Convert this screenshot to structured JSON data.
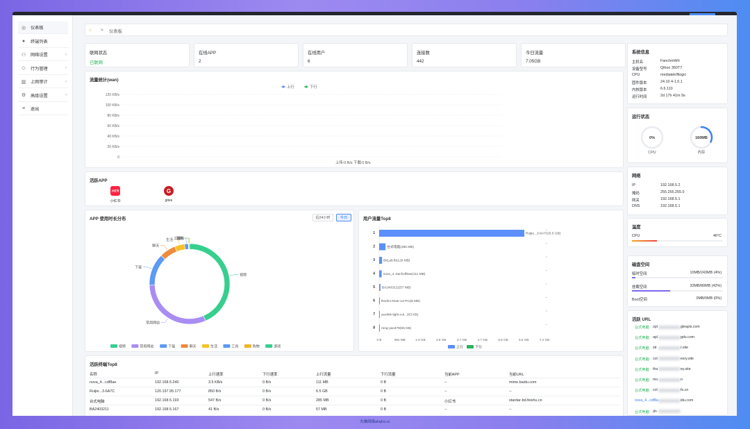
{
  "sidebar": {
    "items": [
      {
        "label": "仪表板",
        "icon": "dashboard-icon",
        "glyph": "◎",
        "arrow": ""
      },
      {
        "label": "终端列表",
        "icon": "user-icon",
        "glyph": "●",
        "arrow": ""
      },
      {
        "label": "网络设置",
        "icon": "network-icon",
        "glyph": "⚇",
        "arrow": "›"
      },
      {
        "label": "行为管理",
        "icon": "shield-icon",
        "glyph": "◇",
        "arrow": "›"
      },
      {
        "label": "上网审计",
        "icon": "audit-icon",
        "glyph": "▥",
        "arrow": "›"
      },
      {
        "label": "高级设置",
        "icon": "gear-icon",
        "glyph": "⚙",
        "arrow": "›"
      },
      {
        "label": "退出",
        "icon": "logout-icon",
        "glyph": "≡",
        "arrow": ""
      }
    ]
  },
  "breadcrumb": {
    "home_glyph": "⌂",
    "sep": ">",
    "current": "仪表板"
  },
  "stats": [
    {
      "label": "联网状态",
      "value": "已联网",
      "green": true
    },
    {
      "label": "在线APP",
      "value": "2",
      "green": false
    },
    {
      "label": "在线用户",
      "value": "6",
      "green": false
    },
    {
      "label": "连接数",
      "value": "442",
      "green": false
    },
    {
      "label": "今日流量",
      "value": "7.05GB",
      "green": false
    }
  ],
  "traffic": {
    "title": "流量统计(wan)",
    "legend": [
      "上行",
      "下行"
    ],
    "legend_colors": [
      "#5b8ff9",
      "#2cb25d"
    ],
    "yticks": [
      "120 KB/s",
      "100 KB/s",
      "80 KB/s",
      "60 KB/s",
      "40 KB/s",
      "20 KB/s",
      "0"
    ],
    "footer": "上传:0 B/s    下载:0 B/s"
  },
  "active_apps": {
    "title": "活跃APP",
    "apps": [
      {
        "name": "小红书",
        "icon_text": "小红书",
        "color": "#ff2442"
      },
      {
        "name": "gitee",
        "icon_text": "G",
        "color": "#c71d23"
      }
    ]
  },
  "app_usage": {
    "title": "APP 使用时长分布",
    "btn_24h": "近24小时",
    "btn_today": "今日"
  },
  "user_top": {
    "title": "用户流量Top8"
  },
  "chart_data": [
    {
      "type": "pie",
      "title": "APP 使用时长分布",
      "categories": [
        "视频",
        "常用网站",
        "下载",
        "聊天",
        "生活",
        "工具",
        "购物",
        "游戏"
      ],
      "values": [
        43.5,
        31,
        13,
        6.5,
        4,
        1.5,
        0.2,
        0.3
      ],
      "colors": [
        "#36cf8e",
        "#a98df2",
        "#5b9af5",
        "#f08a3c",
        "#f7c12a",
        "#5b9af5",
        "#f0b429",
        "#36cf8e"
      ]
    },
    {
      "type": "bar",
      "title": "用户流量Top8",
      "categories": [
        "Ruijie...3-6A7C(6.5 GB)",
        "台式电脑(285 MB)",
        "BitLab.lb(129 MB)",
        "nova_4..5acfcdf8ae(111 MB)",
        "BA2403211(57 MB)",
        "Redmi-Note-14-Pro(6 MB)",
        "yeelink-light-col...(63 KB)",
        "rong-yao479(55 KB)"
      ],
      "ranks": [
        "1",
        "2",
        "3",
        "4",
        "5",
        "6",
        "7",
        "8"
      ],
      "values": [
        6.5,
        0.285,
        0.129,
        0.111,
        0.057,
        0.006,
        6e-05,
        5e-05
      ],
      "xticks": [
        "0 B",
        "954 MB",
        "1.9 GB",
        "2.8 GB",
        "3.7 GB",
        "4.7 GB",
        "5.6 GB",
        "6.5 GB",
        "7.4 GB"
      ],
      "xlim": [
        0,
        7.4
      ],
      "legend": [
        "上行",
        "下行"
      ],
      "legend_colors": [
        "#5b8ff9",
        "#2cb25d"
      ]
    }
  ],
  "terminals": {
    "title": "活跃终端Top8",
    "headers": [
      "名称",
      "IP",
      "上行速率",
      "下行速率",
      "上行流量",
      "下行流量",
      "当前APP",
      "当前URL"
    ],
    "rows": [
      [
        "nova_4...cdf8ae",
        "192.168.5.240",
        "3.5 KB/s",
        "0 B/s",
        "111 MB",
        "0 B",
        "--",
        "mime.baidu.com"
      ],
      [
        "Ruijie...3-6A7C",
        "120.197.95.177",
        "850 B/s",
        "0 B/s",
        "6.5 GB",
        "0 B",
        "--",
        "--"
      ],
      [
        "台式电脑",
        "192.168.5.193",
        "547 B/s",
        "0 B/s",
        "285 MB",
        "0 B",
        "小红书",
        "stardar-bd.feishu.cn"
      ],
      [
        "BA2403211",
        "192.168.5.167",
        "41 B/s",
        "0 B/s",
        "57 MB",
        "0 B",
        "--",
        "--"
      ]
    ]
  },
  "sysinfo": {
    "title": "系统信息",
    "rows": [
      [
        "主机名",
        "FanchmWrt"
      ],
      [
        "设备型号",
        "Qihoo 360T7"
      ],
      [
        "CPU",
        "mediatek/filogic"
      ],
      [
        "固件版本",
        "24.10 4-1.0.1"
      ],
      [
        "内核版本",
        "6.6.110"
      ],
      [
        "运行时间",
        "2d 17h 41m 9s"
      ]
    ]
  },
  "runstate": {
    "title": "运行状态",
    "cpu_value": "0%",
    "cpu_label": "CPU",
    "cpu_pct": 0,
    "mem_value": "160MB",
    "mem_label": "内存",
    "mem_pct": 0.32
  },
  "network": {
    "title": "网络",
    "rows": [
      [
        "IP",
        "192.168.5.2"
      ],
      [
        "掩码",
        "255.255.255.0"
      ],
      [
        "网关",
        "192.168.5.1"
      ],
      [
        "DNS",
        "192.168.5.1"
      ]
    ]
  },
  "temp": {
    "title": "温度",
    "label": "CPU",
    "value": "46°C",
    "pct": 0.46
  },
  "disk": {
    "title": "磁盘空间",
    "rows": [
      {
        "label": "临时空间",
        "value": "10MB/243MB (4%)",
        "pct": 0.04,
        "color": "#7b68ee"
      },
      {
        "label": "挂载空间",
        "value": "33MB/80MB (42%)",
        "pct": 0.42,
        "color": "#7b68ee"
      },
      {
        "label": "Boot空间",
        "value": "0MB/0MB (0%)",
        "pct": 0,
        "color": "#7b68ee"
      }
    ]
  },
  "urls": {
    "title": "活跃 URL",
    "rows": [
      {
        "src": "台式电脑",
        "pre": "opl",
        "suf": "gleapis.com"
      },
      {
        "src": "台式电脑",
        "pre": "apl",
        "suf": "gdu.com"
      },
      {
        "src": "台式电脑",
        "pre": "str",
        "suf": "r.site"
      },
      {
        "src": "台式电脑",
        "pre": "col",
        "suf": "esry.site"
      },
      {
        "src": "台式电脑",
        "pre": "tha",
        "suf": "ey.site"
      },
      {
        "src": "台式电脑",
        "pre": "mo",
        "suf": "n"
      },
      {
        "src": "台式电脑",
        "pre": "col",
        "suf": "fu.cn"
      },
      {
        "src": "nova_4...cdf8a",
        "pre": "",
        "suf": "idu.com"
      },
      {
        "src": "台式电脑",
        "pre": "dn",
        "suf": ""
      }
    ]
  },
  "watermark": "大雄网络ahqhs.cc"
}
